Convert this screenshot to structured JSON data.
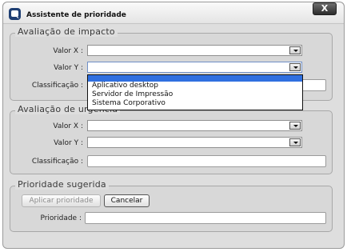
{
  "dialog": {
    "title": "Assistente de prioridade",
    "close_label": "X"
  },
  "impact": {
    "legend": "Avaliação de impacto",
    "valor_x_label": "Valor X :",
    "valor_y_label": "Valor Y :",
    "classificacao_label": "Classificação :",
    "valor_x_value": "",
    "valor_y_value": "",
    "classificacao_value": ""
  },
  "dropdown": {
    "options": [
      "Aplicativo desktop",
      "Servidor de Impressão",
      "Sistema Corporativo"
    ]
  },
  "urgency": {
    "legend": "Avaliação de urgência",
    "valor_x_label": "Valor X :",
    "valor_y_label": "Valor Y :",
    "classificacao_label": "Classificação :",
    "valor_x_value": "",
    "valor_y_value": "",
    "classificacao_value": ""
  },
  "suggested": {
    "legend": "Prioridade sugerida",
    "apply_label": "Aplicar prioridade",
    "cancel_label": "Cancelar",
    "prioridade_label": "Prioridade :",
    "prioridade_value": ""
  }
}
